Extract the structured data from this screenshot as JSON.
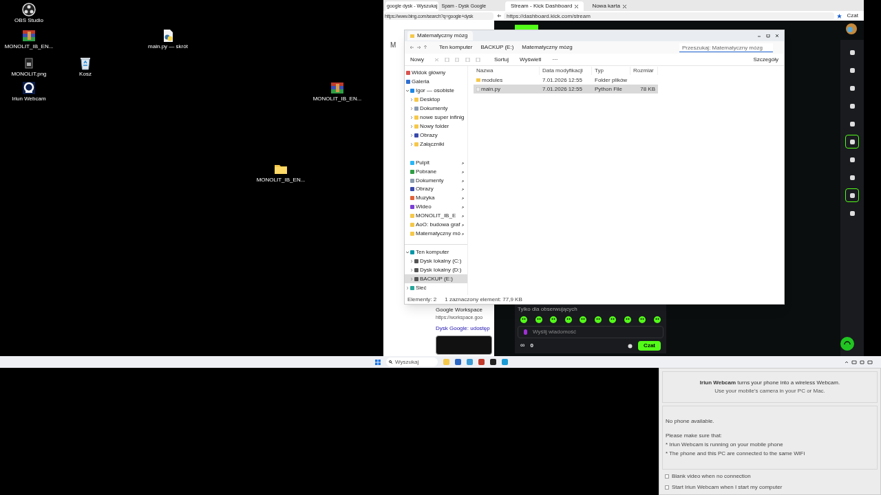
{
  "desktop_icons": [
    {
      "label": "OBS Studio",
      "kind": "obs"
    },
    {
      "label": "MONOLIT_IB_EN...",
      "kind": "archive"
    },
    {
      "label": "MONOLIT.png",
      "kind": "image"
    },
    {
      "label": "Kosz",
      "kind": "bin"
    },
    {
      "label": "Iriun Webcam",
      "kind": "webcam"
    },
    {
      "label": "main.py — skrót",
      "kind": "python"
    },
    {
      "label": "MONOLIT_IB_EN...",
      "kind": "archive"
    },
    {
      "label": "MONOLIT_IB_EN...",
      "kind": "folder"
    }
  ],
  "browser_back": {
    "tabs": [
      {
        "label": "google dysk - Wyszukaj",
        "selected": true
      },
      {
        "label": "Spam - Dysk Google",
        "selected": false
      }
    ],
    "url": "https://www.bing.com/search?q=google+dysk",
    "logo_letter": "M",
    "result_source": "Google Workspace",
    "result_url": "https://workspace.goo",
    "result_title": "Dysk Google: udostęp"
  },
  "browser_kick": {
    "tabs": [
      {
        "label": "Stream - Kick Dashboard",
        "selected": true
      },
      {
        "label": "Nowa karta",
        "selected": false
      }
    ],
    "url": "https://dashboard.kick.com/stream",
    "copilot": "Czat",
    "sidebar_tools": [
      {
        "selected": false
      },
      {
        "selected": false
      },
      {
        "selected": false
      },
      {
        "selected": false
      },
      {
        "selected": false
      },
      {
        "selected": true
      },
      {
        "selected": false
      },
      {
        "selected": false
      },
      {
        "selected": true
      },
      {
        "selected": false
      }
    ],
    "chat": {
      "mode": "Tylko dla obserwujących",
      "placeholder": "Wyślij wiadomość",
      "infinity": "∞",
      "points": "0",
      "send": "Czat"
    }
  },
  "explorer": {
    "tab": "Matematyczny mózg",
    "breadcrumb": [
      "Ten komputer",
      "BACKUP (E:)",
      "Matematyczny mózg"
    ],
    "search_placeholder": "Przeszukaj: Matematyczny mózg",
    "toolbar": {
      "new": "Nowy",
      "sort": "Sortuj",
      "view": "Wyświetl",
      "more": "···",
      "details": "Szczegóły"
    },
    "columns": [
      "Nazwa",
      "Data modyfikacji",
      "Typ",
      "Rozmiar"
    ],
    "rows": [
      {
        "kind": "folder",
        "cells": [
          "modules",
          "7.01.2026 12:55",
          "Folder plików",
          ""
        ],
        "selected": false
      },
      {
        "kind": "file",
        "cells": [
          "main.py",
          "7.01.2026 12:55",
          "Python File",
          "78 KB"
        ],
        "selected": true
      }
    ],
    "nav": [
      {
        "label": "Widok główny",
        "kind": "home",
        "selected": false
      },
      {
        "label": "Galeria",
        "kind": "gallery",
        "selected": false
      },
      {
        "label": "Igor — osobiste",
        "kind": "cloud",
        "selected": false,
        "expanded": true,
        "children": [
          {
            "label": "Desktop",
            "kind": "folder",
            "selected": false,
            "expanded": false
          },
          {
            "label": "Dokumenty",
            "kind": "doc",
            "selected": false,
            "expanded": false
          },
          {
            "label": "nowe super infinig",
            "kind": "folder",
            "selected": false,
            "expanded": false
          },
          {
            "label": "Nowy folder",
            "kind": "folder",
            "selected": false,
            "expanded": false
          },
          {
            "label": "Obrazy",
            "kind": "pictures",
            "selected": false,
            "expanded": false
          },
          {
            "label": "Załączniki",
            "kind": "folder",
            "selected": false,
            "expanded": false
          }
        ]
      }
    ],
    "pinned": [
      {
        "label": "Pulpit",
        "kind": "desktop"
      },
      {
        "label": "Pobrane",
        "kind": "download"
      },
      {
        "label": "Dokumenty",
        "kind": "doc"
      },
      {
        "label": "Obrazy",
        "kind": "pictures"
      },
      {
        "label": "Muzyka",
        "kind": "music"
      },
      {
        "label": "Wideo",
        "kind": "video"
      },
      {
        "label": "MONOLIT_IB_E",
        "kind": "folder"
      },
      {
        "label": "AoO: budowa graf",
        "kind": "folder"
      },
      {
        "label": "Matematyczny mó",
        "kind": "folder"
      }
    ],
    "drives": [
      {
        "label": "Ten komputer",
        "kind": "pc",
        "selected": false,
        "expanded": true,
        "children": [
          {
            "label": "Dysk lokalny (C:)",
            "kind": "drive",
            "selected": false,
            "expanded": false
          },
          {
            "label": "Dysk lokalny (D:)",
            "kind": "drive",
            "selected": false,
            "expanded": false
          },
          {
            "label": "BACKUP (E:)",
            "kind": "drive",
            "selected": true,
            "expanded": false
          }
        ]
      },
      {
        "label": "Sieć",
        "kind": "network",
        "selected": false,
        "expanded": false
      }
    ],
    "status": [
      "Elementy: 2",
      "1 zaznaczony element: 77,9 KB"
    ]
  },
  "taskbar": {
    "search_placeholder": "Wyszukaj"
  },
  "iriun": {
    "intro": "**Iriun Webcam** turns your phone into a wireless Webcam.",
    "intro2": "Use your mobile's camera in your PC or Mac.",
    "status": "No phone available.",
    "hint": "Please make sure that:",
    "bullets": [
      "* Iriun Webcam is running on your mobile phone",
      "* The phone and this PC are connected to the same WiFi"
    ],
    "options": [
      {
        "label": "Blank video when no connection",
        "checked": false
      },
      {
        "label": "Start Iriun Webcam when I start my computer",
        "checked": false
      }
    ]
  }
}
